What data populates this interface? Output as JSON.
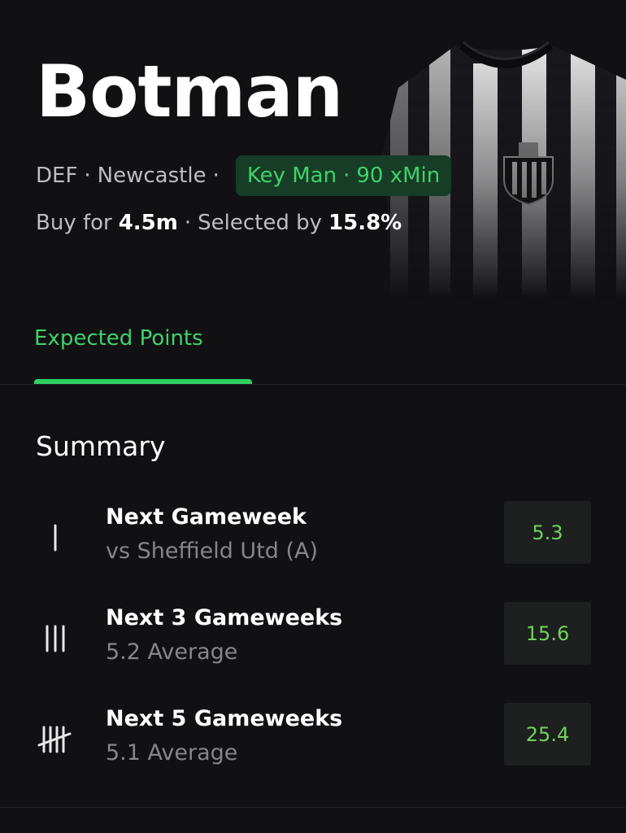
{
  "player": {
    "name": "Botman",
    "position": "DEF",
    "team": "Newcastle",
    "badge_role": "Key Man",
    "badge_minutes": "90 xMin",
    "buy_prefix": "Buy for",
    "price": "4.5m",
    "selected_prefix": "Selected by",
    "selected_pct": "15.8%"
  },
  "tabs": [
    {
      "label": "Expected Points",
      "active": true
    }
  ],
  "summary": {
    "title": "Summary",
    "rows": [
      {
        "title": "Next Gameweek",
        "subtitle": "vs Sheffield Utd (A)",
        "value": "5.3",
        "icon": "tally-1-icon"
      },
      {
        "title": "Next 3 Gameweeks",
        "subtitle": "5.2 Average",
        "value": "15.6",
        "icon": "tally-3-icon"
      },
      {
        "title": "Next 5 Gameweeks",
        "subtitle": "5.1 Average",
        "value": "25.4",
        "icon": "tally-5-icon"
      }
    ]
  },
  "colors": {
    "accent": "#3fd26a",
    "badge_bg": "#173d26",
    "background": "#111114"
  }
}
